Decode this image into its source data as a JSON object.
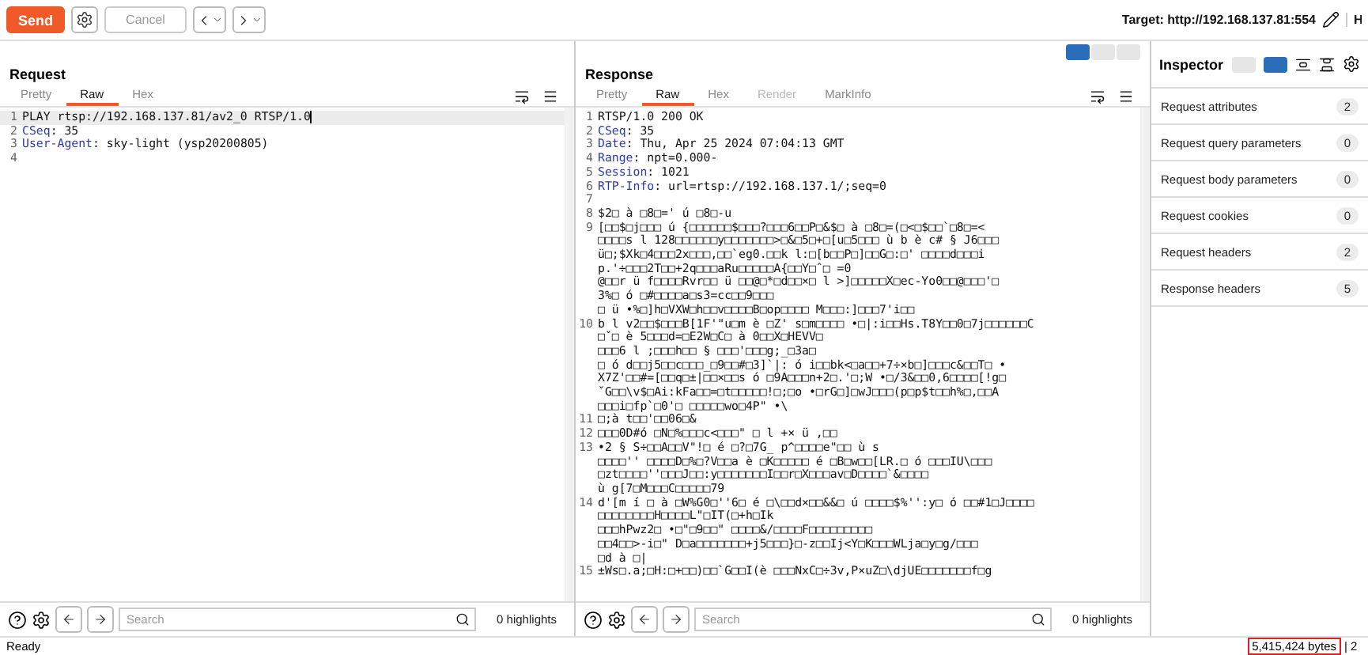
{
  "toolbar": {
    "send": "Send",
    "cancel": "Cancel",
    "cancel_disabled": true,
    "target": "Target: http://192.168.137.81:554",
    "cut_label": "H"
  },
  "request": {
    "title": "Request",
    "tabs": [
      {
        "label": "Pretty",
        "selected": false
      },
      {
        "label": "Raw",
        "selected": true
      },
      {
        "label": "Hex",
        "selected": false
      }
    ],
    "lines": [
      {
        "number": "1",
        "text": "PLAY rtsp://192.168.137.81/av2_0 RTSP/1.0",
        "current": true
      },
      {
        "number": "2",
        "key": "CSeq",
        "text": ": 35",
        "current": false
      },
      {
        "number": "3",
        "key": "User-Agent",
        "text": ": sky-light (ysp20200805)",
        "current": false
      },
      {
        "number": "4",
        "current": false
      }
    ],
    "search": {
      "placeholder": "Search"
    },
    "highlights": "0 highlights"
  },
  "response": {
    "title": "Response",
    "tabs": [
      {
        "label": "Pretty",
        "selected": false
      },
      {
        "label": "Raw",
        "selected": true
      },
      {
        "label": "Hex",
        "selected": false
      },
      {
        "label": "Render",
        "selected": false,
        "disabled": true
      },
      {
        "label": "MarkInfo",
        "selected": false
      }
    ],
    "lines": [
      {
        "number": "1",
        "text": "RTSP/1.0 200 OK"
      },
      {
        "number": "2",
        "key": "CSeq",
        "text": ": 35"
      },
      {
        "number": "3",
        "key": "Date",
        "text": ": Thu, Apr 25 2024 07:04:13 GMT"
      },
      {
        "number": "4",
        "key": "Range",
        "text": ": npt=0.000-"
      },
      {
        "number": "5",
        "key": "Session",
        "text": ": 1021"
      },
      {
        "number": "6",
        "key": "RTP-Info",
        "text": ": url=rtsp://192.168.137.1/;seq=0"
      },
      {
        "number": "7"
      },
      {
        "number": "8",
        "text": "$2□ à □8□=' ú □8□-u"
      },
      {
        "number": "9",
        "text": "[□□$□j□□□ ú {□□□□□□$□□□?□□□6□□P□&$□ à □8□=(□<□$□□`□8□=<"
      },
      {
        "text": "□□□□s l 128□□□□□□y□□□□□□□>□&□5□+□[u□5□□□ ù b è c# § J6□□□"
      },
      {
        "text": "ü□;$Xk□4□□□2x□□□,□□`eg0.□□k l:□[b□□P□]□□G□:□' □□□□d□□□i"
      },
      {
        "text": "p.'÷□□□2T□□+2q□□□aRu□□□□□A{□□Y□ˆ□ =0"
      },
      {
        "text": "@□□r ü f□□□□Rvr□□ ü □□@□*□d□□×□ l >]□□□□□X□ec-Yo0□□@□□□'□"
      },
      {
        "text": "3%□ ó □#□□□□a□s3=cc□□9□□□"
      },
      {
        "text": "□ ü •%□]h□VXW□h□□v□□□□B□op□□□□ M□□□:]□□□7'i□□"
      },
      {
        "number": "10",
        "text": "b l v2□□$□□□B[1F'\"u□m è □Z' s□m□□□□ •□|:i□□Hs.T8Y□□0□7j□□□□□□C"
      },
      {
        "text": "□ˇ□ è 5□□□d=□E2W□C□ à 0□□X□HEVV□"
      },
      {
        "text": "□□□6 l ;□□□h□□ § □□□'□□□g;_□3a□"
      },
      {
        "text": "□ ó d□□j5□□c□□□_□9□□#□3]`|: ó i□□bk<□a□□+7÷×b□]□□□c&□□T□ •"
      },
      {
        "text": "X7Z'□□#=[□□q□±|□□×□□s ó □9A□□□n+2□.'□;W •□/3&□□0,6□□□□[!g□"
      },
      {
        "text": "ˇG□□\\v$□Ai:kFa□□=□t□□□□□!□;□o •□rG□]□wJ□□□(p□p$t□□h%□,□□A"
      },
      {
        "text": "□□□i□fp`□0'□ □□□□□wo□4P\" •\\"
      },
      {
        "number": "11",
        "text": "□;à t□□'□□06□&"
      },
      {
        "number": "12",
        "text": "□□□0D#ó □N□%□□□c<□□□\" □ l +× ü ,□□"
      },
      {
        "number": "13",
        "text": "•2 § S÷□□A□□V\"!□ é □?□7G_ p^□□□□e\"□□ ù s"
      },
      {
        "text": "□□□□'' □□□□D□%□?V□□a è □K□□□□□ é □B□w□□[LR.□ ó □□□IU\\□□□"
      },
      {
        "text": "□zt□□□□''□□□J□□:y□□□□□□□I□□r□X□□□av□D□□□□`&□□□□"
      },
      {
        "text": "ù g[7□M□□□C□□□□□79"
      },
      {
        "number": "14",
        "text": "d'[m í □ à □W%G0□''6□ é □\\□□d×□□&&□ ú □□□□$%'':y□ ó □□#1□J□□□□"
      },
      {
        "text": "□□□□□□□□H□□□□L\"□IT(□+h□Ik"
      },
      {
        "text": "□□□hPwz2□ •□\"□9□□\" □□□□&/□□□□F□□□□□□□□□"
      },
      {
        "text": "□□4□□>-i□\" D□a□□□□□□□+j5□□□}□-z□□Ij<Y□K□□□WLja□y□g/□□□"
      },
      {
        "text": "□d à □|"
      },
      {
        "number": "15",
        "text": "±Ws□.a;□H:□+□□)□□`G□□I(è □□□NxC□÷3v,P×uZ□\\djUE□□□□□□□f□g"
      }
    ],
    "search": {
      "placeholder": "Search"
    },
    "highlights": "0 highlights"
  },
  "inspector": {
    "title": "Inspector",
    "rows": [
      {
        "label": "Request attributes",
        "count": "2"
      },
      {
        "label": "Request query parameters",
        "count": "0"
      },
      {
        "label": "Request body parameters",
        "count": "0"
      },
      {
        "label": "Request cookies",
        "count": "0"
      },
      {
        "label": "Request headers",
        "count": "2"
      },
      {
        "label": "Response headers",
        "count": "5"
      }
    ]
  },
  "status_bar": {
    "text": "Ready",
    "bytes": "5,415,424 bytes",
    "bytes_marked": true,
    "cut_text": "| 2"
  }
}
